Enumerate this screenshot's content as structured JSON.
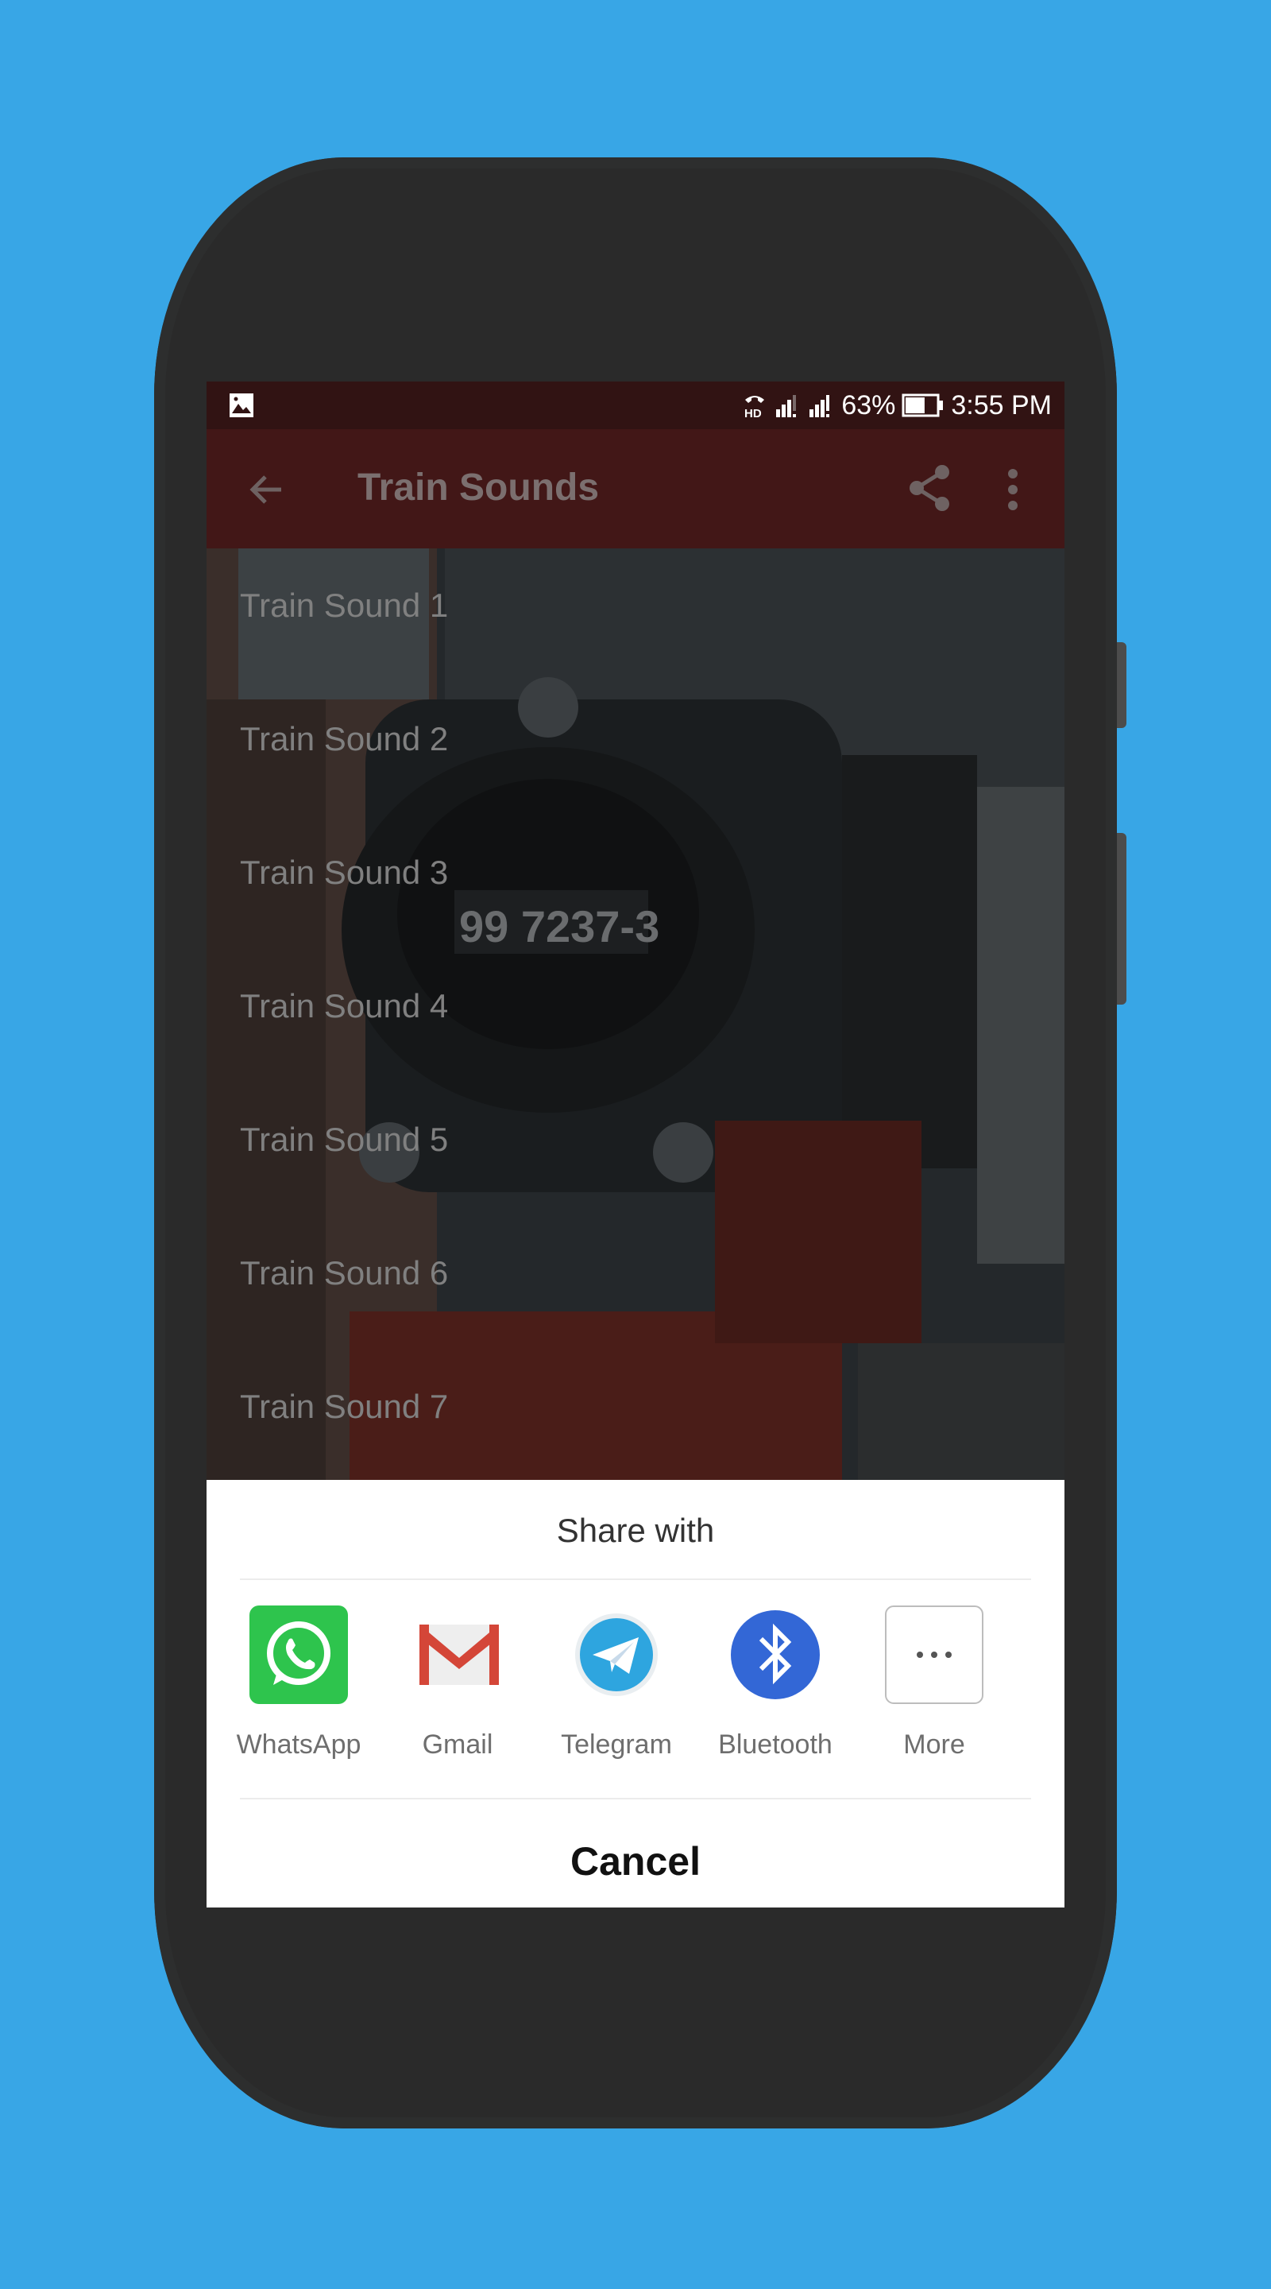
{
  "status_bar": {
    "notification_icon": "image-icon",
    "indicators": [
      "hd-call-icon",
      "signal-sim1-icon",
      "signal-sim2-icon"
    ],
    "battery_percent": "63%",
    "battery_level": 0.63,
    "time": "3:55 PM"
  },
  "app_bar": {
    "title": "Train Sounds",
    "back_icon": "arrow-left-icon",
    "share_icon": "share-icon",
    "overflow_icon": "more-vert-icon"
  },
  "list": {
    "items": [
      {
        "label": "Train Sound 1"
      },
      {
        "label": "Train Sound 2"
      },
      {
        "label": "Train Sound 3"
      },
      {
        "label": "Train Sound 4"
      },
      {
        "label": "Train Sound 5"
      },
      {
        "label": "Train Sound 6"
      },
      {
        "label": "Train Sound 7"
      }
    ],
    "background_image_text": "99 7237-3"
  },
  "share_sheet": {
    "title": "Share with",
    "apps": [
      {
        "label": "WhatsApp",
        "icon": "whatsapp-icon",
        "color": "#2ec44d"
      },
      {
        "label": "Gmail",
        "icon": "gmail-icon",
        "color": "#d44638"
      },
      {
        "label": "Telegram",
        "icon": "telegram-icon",
        "color": "#2ea5df"
      },
      {
        "label": "Bluetooth",
        "icon": "bluetooth-icon",
        "color": "#3367d6"
      },
      {
        "label": "More",
        "icon": "more-horiz-icon",
        "color": "#ffffff"
      }
    ],
    "cancel_label": "Cancel"
  },
  "colors": {
    "background": "#38a6e6",
    "phone_body": "#2a2a2a",
    "status_bar": "#311313",
    "app_bar": "#421717",
    "sheet": "#ffffff"
  }
}
